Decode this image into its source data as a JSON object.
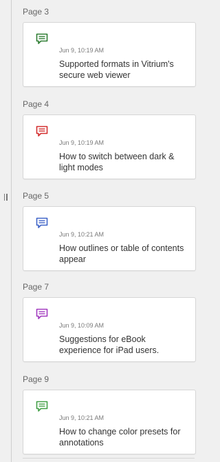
{
  "annotations": [
    {
      "page_label": "Page 3",
      "timestamp": "Jun 9, 10:19 AM",
      "text": "Supported formats in Vitrium's secure web viewer",
      "icon": "comment-icon",
      "color": "#2e7d32"
    },
    {
      "page_label": "Page 4",
      "timestamp": "Jun 9, 10:19 AM",
      "text": "How to switch between dark & light modes",
      "icon": "comment-icon",
      "color": "#d32f2f"
    },
    {
      "page_label": "Page 5",
      "timestamp": "Jun 9, 10:21 AM",
      "text": "How outlines or table of contents appear",
      "icon": "comment-icon",
      "color": "#3f64c8"
    },
    {
      "page_label": "Page 7",
      "timestamp": "Jun 9, 10:09 AM",
      "text": "Suggestions for eBook experience for iPad users.",
      "icon": "comment-icon",
      "color": "#a23bbf"
    },
    {
      "page_label": "Page 9",
      "timestamp": "Jun 9, 10:21 AM",
      "text": "How to change color presets for annotations",
      "icon": "comment-icon",
      "color": "#43a047"
    }
  ],
  "drag_handle_icon": "vertical-grip-icon"
}
